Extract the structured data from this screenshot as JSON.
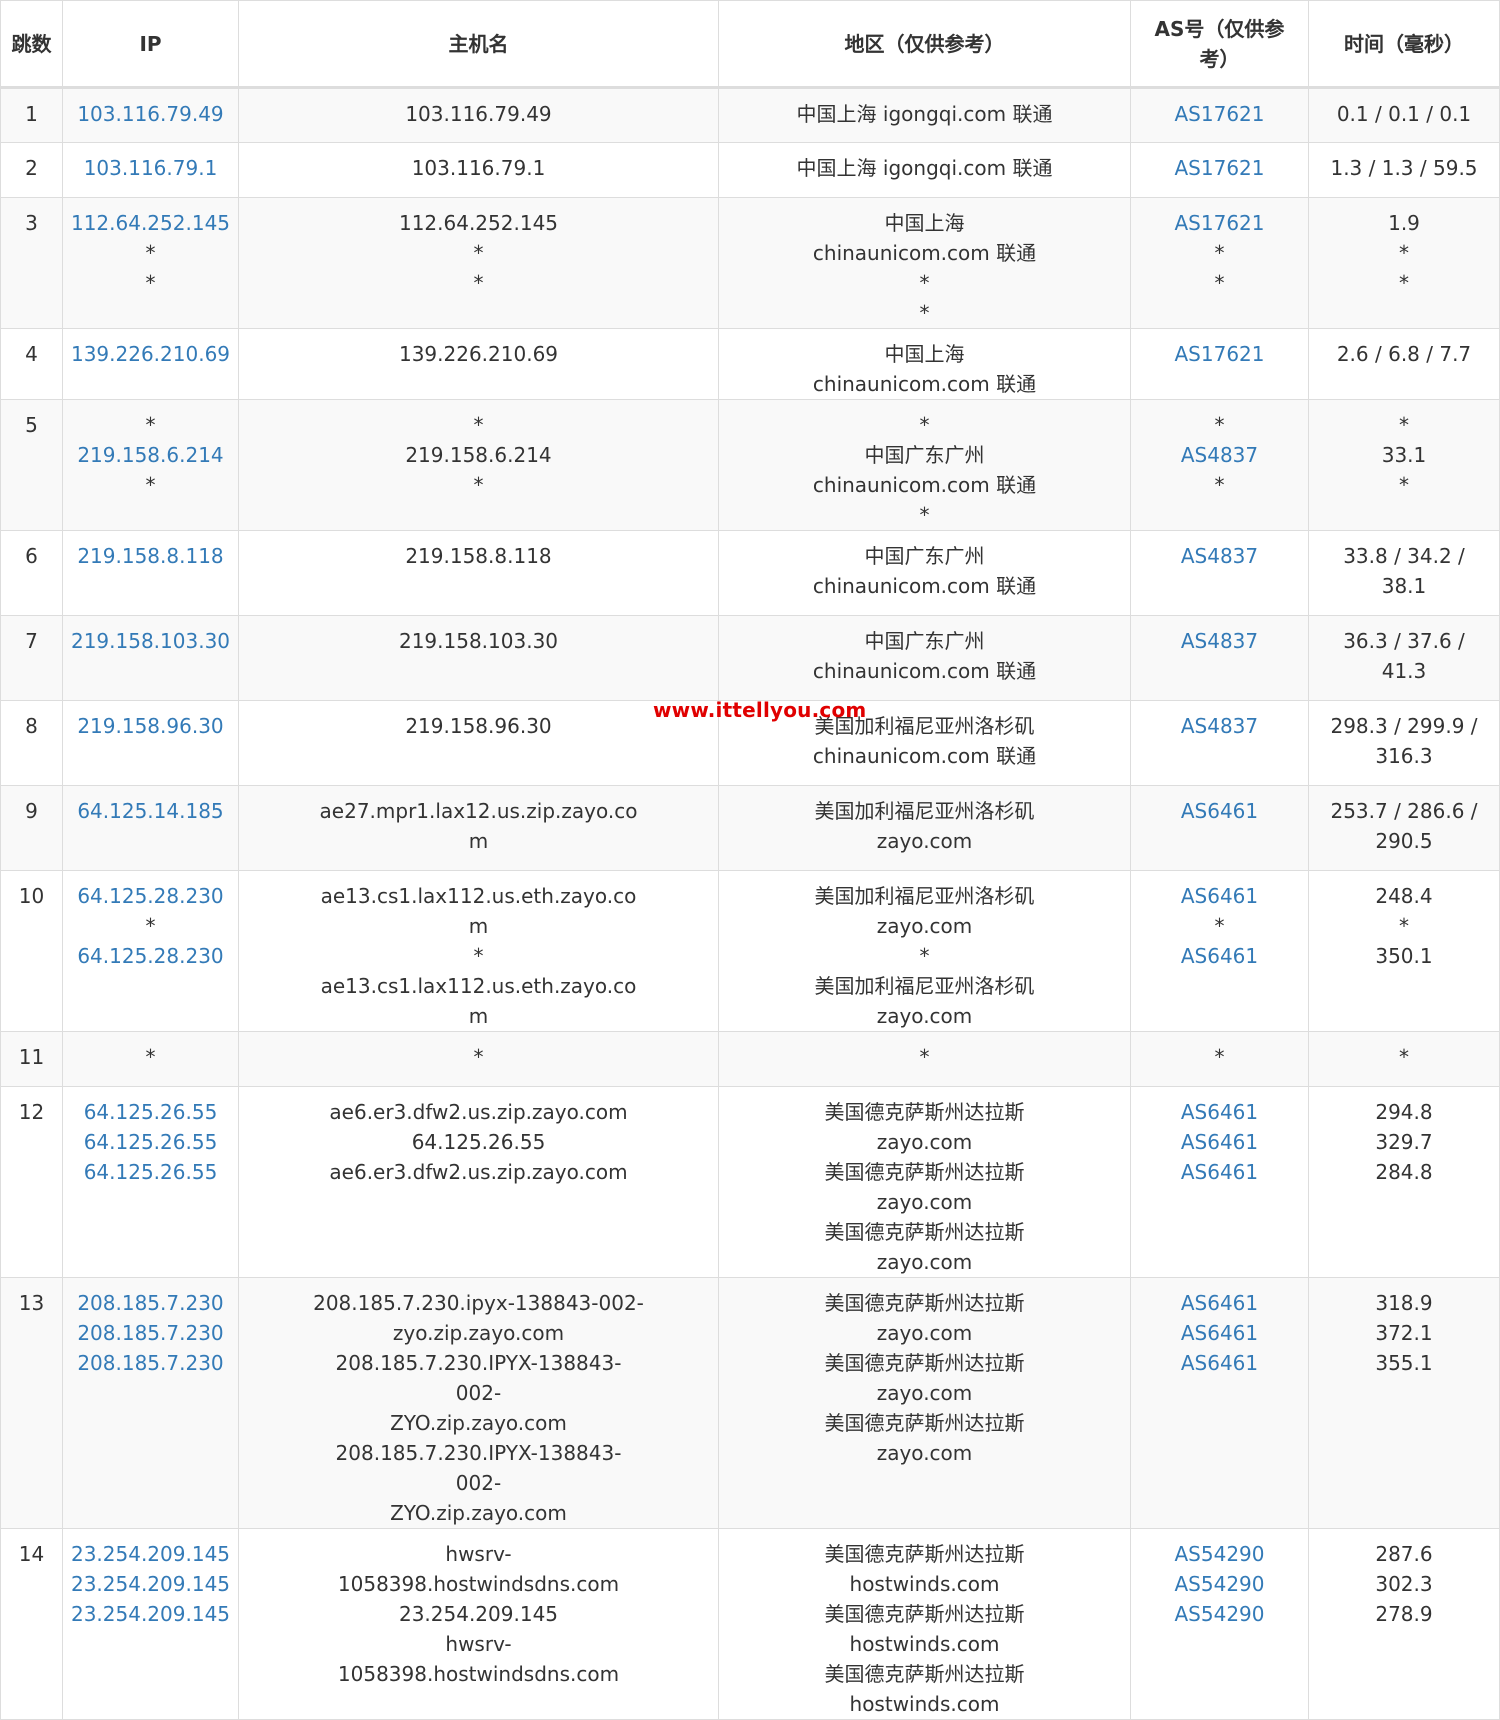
{
  "headers": {
    "hop": "跳数",
    "ip": "IP",
    "host": "主机名",
    "region": "地区（仅供参考）",
    "as": "AS号（仅供参考）",
    "time": "时间（毫秒）"
  },
  "rows": [
    {
      "hop": "1",
      "ip": [
        "103.116.79.49"
      ],
      "host": [
        "103.116.79.49"
      ],
      "region": [
        "中国上海 igongqi.com 联通"
      ],
      "as": [
        "AS17621"
      ],
      "time": [
        "0.1 / 0.1 / 0.1"
      ]
    },
    {
      "hop": "2",
      "ip": [
        "103.116.79.1"
      ],
      "host": [
        "103.116.79.1"
      ],
      "region": [
        "中国上海 igongqi.com 联通"
      ],
      "as": [
        "AS17621"
      ],
      "time": [
        "1.3 / 1.3 / 59.5"
      ]
    },
    {
      "hop": "3",
      "ip": [
        "112.64.252.145",
        "*",
        "*"
      ],
      "host": [
        "112.64.252.145",
        "*",
        "*"
      ],
      "region": [
        "中国上海 chinaunicom.com 联通",
        "*",
        "*"
      ],
      "as": [
        "AS17621",
        "*",
        "*"
      ],
      "time": [
        "1.9",
        "*",
        "*"
      ]
    },
    {
      "hop": "4",
      "ip": [
        "139.226.210.69"
      ],
      "host": [
        "139.226.210.69"
      ],
      "region": [
        "中国上海 chinaunicom.com 联通"
      ],
      "as": [
        "AS17621"
      ],
      "time": [
        "2.6 / 6.8 / 7.7"
      ]
    },
    {
      "hop": "5",
      "ip": [
        "*",
        "219.158.6.214",
        "*"
      ],
      "host": [
        "*",
        "219.158.6.214",
        "*"
      ],
      "region": [
        "*",
        "中国广东广州 chinaunicom.com 联通",
        "*"
      ],
      "as": [
        "*",
        "AS4837",
        "*"
      ],
      "time": [
        "*",
        "33.1",
        "*"
      ]
    },
    {
      "hop": "6",
      "ip": [
        "219.158.8.118"
      ],
      "host": [
        "219.158.8.118"
      ],
      "region": [
        "中国广东广州 chinaunicom.com 联通"
      ],
      "as": [
        "AS4837"
      ],
      "time": [
        "33.8 / 34.2 / 38.1"
      ]
    },
    {
      "hop": "7",
      "ip": [
        "219.158.103.30"
      ],
      "host": [
        "219.158.103.30"
      ],
      "region": [
        "中国广东广州 chinaunicom.com 联通"
      ],
      "as": [
        "AS4837"
      ],
      "time": [
        "36.3 / 37.6 / 41.3"
      ]
    },
    {
      "hop": "8",
      "ip": [
        "219.158.96.30"
      ],
      "host": [
        "219.158.96.30"
      ],
      "region": [
        "美国加利福尼亚州洛杉矶 chinaunicom.com 联通"
      ],
      "as": [
        "AS4837"
      ],
      "time": [
        "298.3 / 299.9 / 316.3"
      ]
    },
    {
      "hop": "9",
      "ip": [
        "64.125.14.185"
      ],
      "host": [
        "ae27.mpr1.lax12.us.zip.zayo.com"
      ],
      "region": [
        "美国加利福尼亚州洛杉矶 zayo.com"
      ],
      "as": [
        "AS6461"
      ],
      "time": [
        "253.7 / 286.6 / 290.5"
      ]
    },
    {
      "hop": "10",
      "ip": [
        "64.125.28.230",
        "*",
        "64.125.28.230"
      ],
      "host": [
        "ae13.cs1.lax112.us.eth.zayo.com",
        "*",
        "ae13.cs1.lax112.us.eth.zayo.com"
      ],
      "region": [
        "美国加利福尼亚州洛杉矶 zayo.com",
        "*",
        "美国加利福尼亚州洛杉矶 zayo.com"
      ],
      "as": [
        "AS6461",
        "*",
        "AS6461"
      ],
      "time": [
        "248.4",
        "*",
        "350.1"
      ]
    },
    {
      "hop": "11",
      "ip": [
        "*"
      ],
      "host": [
        "*"
      ],
      "region": [
        "*"
      ],
      "as": [
        "*"
      ],
      "time": [
        "*"
      ]
    },
    {
      "hop": "12",
      "ip": [
        "64.125.26.55",
        "64.125.26.55",
        "64.125.26.55"
      ],
      "host": [
        "ae6.er3.dfw2.us.zip.zayo.com",
        "64.125.26.55",
        "ae6.er3.dfw2.us.zip.zayo.com"
      ],
      "region": [
        "美国德克萨斯州达拉斯 zayo.com",
        "美国德克萨斯州达拉斯 zayo.com",
        "美国德克萨斯州达拉斯 zayo.com"
      ],
      "as": [
        "AS6461",
        "AS6461",
        "AS6461"
      ],
      "time": [
        "294.8",
        "329.7",
        "284.8"
      ]
    },
    {
      "hop": "13",
      "ip": [
        "208.185.7.230",
        "208.185.7.230",
        "208.185.7.230"
      ],
      "host": [
        "208.185.7.230.ipyx-138843-002-zyo.zip.zayo.com",
        "208.185.7.230.IPYX-138843-002-ZYO.zip.zayo.com",
        "208.185.7.230.IPYX-138843-002-ZYO.zip.zayo.com"
      ],
      "region": [
        "美国德克萨斯州达拉斯 zayo.com",
        "美国德克萨斯州达拉斯 zayo.com",
        "美国德克萨斯州达拉斯 zayo.com"
      ],
      "as": [
        "AS6461",
        "AS6461",
        "AS6461"
      ],
      "time": [
        "318.9",
        "372.1",
        "355.1"
      ]
    },
    {
      "hop": "14",
      "ip": [
        "23.254.209.145",
        "23.254.209.145",
        "23.254.209.145"
      ],
      "host": [
        "hwsrv-1058398.hostwindsdns.com",
        "23.254.209.145",
        "hwsrv-1058398.hostwindsdns.com"
      ],
      "region": [
        "美国德克萨斯州达拉斯 hostwinds.com",
        "美国德克萨斯州达拉斯 hostwinds.com",
        "美国德克萨斯州达拉斯 hostwinds.com"
      ],
      "as": [
        "AS54290",
        "AS54290",
        "AS54290"
      ],
      "time": [
        "287.6",
        "302.3",
        "278.9"
      ]
    }
  ],
  "watermark": "www.ittellyou.com",
  "colors": {
    "link": "#337ab7",
    "stripe": "#f9f9f9",
    "border": "#dddddd",
    "watermark": "#e00000"
  }
}
